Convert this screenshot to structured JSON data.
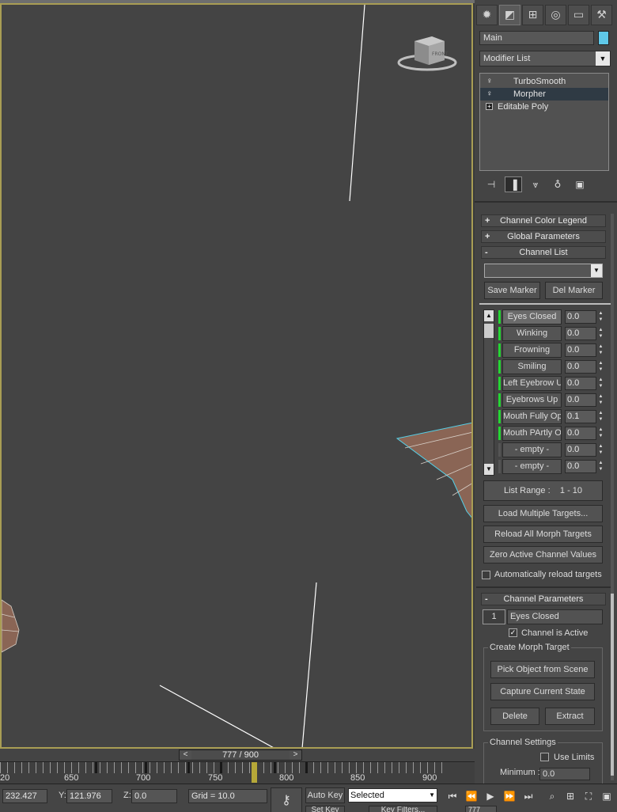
{
  "panel": {
    "tabs": [
      {
        "name": "create-icon",
        "glyph": "✹"
      },
      {
        "name": "modify-icon",
        "glyph": "◩"
      },
      {
        "name": "hierarchy-icon",
        "glyph": "⊞"
      },
      {
        "name": "motion-icon",
        "glyph": "◎"
      },
      {
        "name": "display-icon",
        "glyph": "▭"
      },
      {
        "name": "utilities-icon",
        "glyph": "⚒"
      }
    ],
    "object_name": "Main",
    "object_color": "#5fc8e8",
    "modifier_list": "Modifier List",
    "stack": [
      {
        "label": "TurboSmooth"
      },
      {
        "label": "Morpher"
      },
      {
        "label": "Editable Poly"
      }
    ],
    "stack_tools": {
      "pin": "⊣",
      "show_end": "▐",
      "unique": "⩔",
      "remove": "♁",
      "configure": "▣"
    }
  },
  "rollouts": {
    "channel_color_legend": {
      "sign": "+",
      "label": "Channel Color Legend"
    },
    "global_parameters": {
      "sign": "+",
      "label": "Global Parameters"
    },
    "channel_list": {
      "sign": "-",
      "label": "Channel List"
    },
    "channel_parameters": {
      "sign": "-",
      "label": "Channel Parameters"
    }
  },
  "channel_list": {
    "marker_value": "",
    "save_marker": "Save Marker",
    "del_marker": "Del Marker",
    "channels": [
      {
        "name": "Eyes Closed",
        "value": "0.0",
        "active": true
      },
      {
        "name": "Winking",
        "value": "0.0",
        "active": true
      },
      {
        "name": "Frowning",
        "value": "0.0",
        "active": true
      },
      {
        "name": "Smiling",
        "value": "0.0",
        "active": true
      },
      {
        "name": "Left Eyebrow Up",
        "value": "0.0",
        "active": true
      },
      {
        "name": "Eyebrows Up",
        "value": "0.0",
        "active": true
      },
      {
        "name": "Mouth Fully Open",
        "value": "0.1",
        "active": true
      },
      {
        "name": "Mouth PArtly Open",
        "value": "0.0",
        "active": true
      },
      {
        "name": "- empty -",
        "value": "0.0",
        "active": false
      },
      {
        "name": "- empty -",
        "value": "0.0",
        "active": false
      }
    ],
    "list_range_label": "List Range :",
    "list_range_value": "1 - 10",
    "load_multiple": "Load Multiple Targets...",
    "reload_all": "Reload All Morph Targets",
    "zero_active": "Zero Active Channel Values",
    "auto_reload": "Automatically reload targets"
  },
  "channel_params": {
    "number": "1",
    "name": "Eyes Closed",
    "channel_active": "Channel is Active",
    "create_group": "Create Morph Target",
    "pick_object": "Pick Object from Scene",
    "capture_state": "Capture Current State",
    "delete": "Delete",
    "extract": "Extract",
    "settings_group": "Channel Settings",
    "use_limits": "Use Limits",
    "minimum_label": "Minimum :",
    "minimum_value": "0.0"
  },
  "timeline": {
    "frame": "777 / 900",
    "prev": "<",
    "next": ">",
    "ticks": [
      "20",
      "650",
      "700",
      "750",
      "800",
      "850",
      "900"
    ]
  },
  "status": {
    "x_label": "X:",
    "x_value": "232.427",
    "y_label": "Y:",
    "y_value": "121.976",
    "z_label": "Z:",
    "z_value": "0.0",
    "grid": "Grid = 10.0",
    "auto_key": "Auto Key",
    "selected": "Selected",
    "set_key": "Set Key",
    "key_filters": "Key Filters...",
    "current_frame": "777"
  }
}
